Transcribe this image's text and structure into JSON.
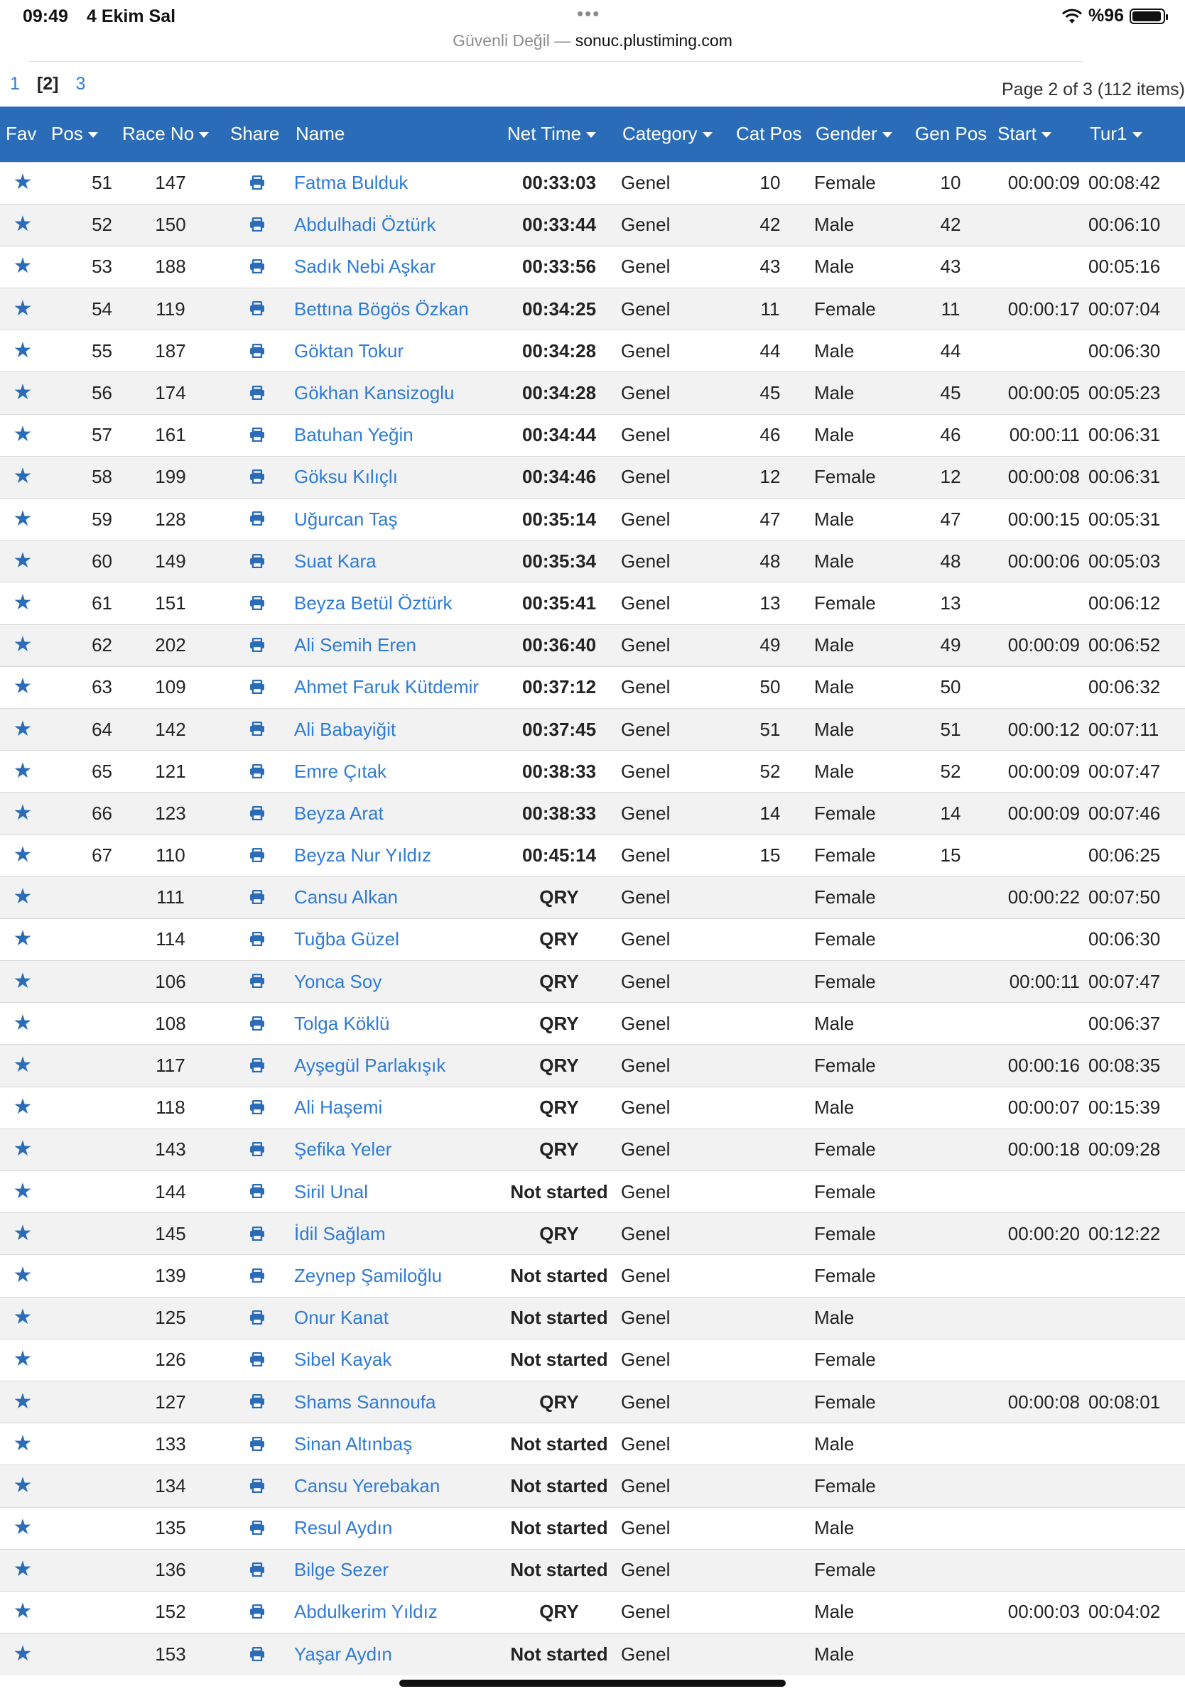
{
  "status_bar": {
    "time": "09:49",
    "date": "4 Ekim Sal",
    "dots": "•••",
    "battery": "%96"
  },
  "url_bar": {
    "security": "Güvenli Değil —",
    "host": "sonuc.plustiming.com"
  },
  "pager": {
    "pages": [
      "1",
      "[2]",
      "3"
    ],
    "info": "Page 2 of 3 (112 items)"
  },
  "columns": [
    {
      "label": "Fav",
      "sort": false
    },
    {
      "label": "Pos",
      "sort": true
    },
    {
      "label": "Race No",
      "sort": true
    },
    {
      "label": "Share",
      "sort": false
    },
    {
      "label": "Name",
      "sort": false
    },
    {
      "label": "Net Time",
      "sort": true
    },
    {
      "label": "Category",
      "sort": true
    },
    {
      "label": "Cat Pos",
      "sort": false
    },
    {
      "label": "Gender",
      "sort": true
    },
    {
      "label": "Gen Pos",
      "sort": false
    },
    {
      "label": "Start",
      "sort": true
    },
    {
      "label": "Tur1",
      "sort": true
    }
  ],
  "rows": [
    {
      "pos": "51",
      "race_no": "147",
      "name": "Fatma Bulduk",
      "net": "00:33:03",
      "category": "Genel",
      "cat_pos": "10",
      "gender": "Female",
      "gen_pos": "10",
      "start": "00:00:09",
      "tur1": "00:08:42"
    },
    {
      "pos": "52",
      "race_no": "150",
      "name": "Abdulhadi Öztürk",
      "net": "00:33:44",
      "category": "Genel",
      "cat_pos": "42",
      "gender": "Male",
      "gen_pos": "42",
      "start": "",
      "tur1": "00:06:10"
    },
    {
      "pos": "53",
      "race_no": "188",
      "name": "Sadık Nebi Aşkar",
      "net": "00:33:56",
      "category": "Genel",
      "cat_pos": "43",
      "gender": "Male",
      "gen_pos": "43",
      "start": "",
      "tur1": "00:05:16"
    },
    {
      "pos": "54",
      "race_no": "119",
      "name": "Bettına Bögös Özkan",
      "net": "00:34:25",
      "category": "Genel",
      "cat_pos": "11",
      "gender": "Female",
      "gen_pos": "11",
      "start": "00:00:17",
      "tur1": "00:07:04"
    },
    {
      "pos": "55",
      "race_no": "187",
      "name": "Göktan Tokur",
      "net": "00:34:28",
      "category": "Genel",
      "cat_pos": "44",
      "gender": "Male",
      "gen_pos": "44",
      "start": "",
      "tur1": "00:06:30"
    },
    {
      "pos": "56",
      "race_no": "174",
      "name": "Gökhan Kansizoglu",
      "net": "00:34:28",
      "category": "Genel",
      "cat_pos": "45",
      "gender": "Male",
      "gen_pos": "45",
      "start": "00:00:05",
      "tur1": "00:05:23"
    },
    {
      "pos": "57",
      "race_no": "161",
      "name": "Batuhan Yeğin",
      "net": "00:34:44",
      "category": "Genel",
      "cat_pos": "46",
      "gender": "Male",
      "gen_pos": "46",
      "start": "00:00:11",
      "tur1": "00:06:31"
    },
    {
      "pos": "58",
      "race_no": "199",
      "name": "Göksu Kılıçlı",
      "net": "00:34:46",
      "category": "Genel",
      "cat_pos": "12",
      "gender": "Female",
      "gen_pos": "12",
      "start": "00:00:08",
      "tur1": "00:06:31"
    },
    {
      "pos": "59",
      "race_no": "128",
      "name": "Uğurcan Taş",
      "net": "00:35:14",
      "category": "Genel",
      "cat_pos": "47",
      "gender": "Male",
      "gen_pos": "47",
      "start": "00:00:15",
      "tur1": "00:05:31"
    },
    {
      "pos": "60",
      "race_no": "149",
      "name": "Suat Kara",
      "net": "00:35:34",
      "category": "Genel",
      "cat_pos": "48",
      "gender": "Male",
      "gen_pos": "48",
      "start": "00:00:06",
      "tur1": "00:05:03"
    },
    {
      "pos": "61",
      "race_no": "151",
      "name": "Beyza Betül Öztürk",
      "net": "00:35:41",
      "category": "Genel",
      "cat_pos": "13",
      "gender": "Female",
      "gen_pos": "13",
      "start": "",
      "tur1": "00:06:12"
    },
    {
      "pos": "62",
      "race_no": "202",
      "name": "Ali Semih Eren",
      "net": "00:36:40",
      "category": "Genel",
      "cat_pos": "49",
      "gender": "Male",
      "gen_pos": "49",
      "start": "00:00:09",
      "tur1": "00:06:52"
    },
    {
      "pos": "63",
      "race_no": "109",
      "name": "Ahmet Faruk Kütdemir",
      "net": "00:37:12",
      "category": "Genel",
      "cat_pos": "50",
      "gender": "Male",
      "gen_pos": "50",
      "start": "",
      "tur1": "00:06:32"
    },
    {
      "pos": "64",
      "race_no": "142",
      "name": "Ali Babayiğit",
      "net": "00:37:45",
      "category": "Genel",
      "cat_pos": "51",
      "gender": "Male",
      "gen_pos": "51",
      "start": "00:00:12",
      "tur1": "00:07:11"
    },
    {
      "pos": "65",
      "race_no": "121",
      "name": "Emre Çıtak",
      "net": "00:38:33",
      "category": "Genel",
      "cat_pos": "52",
      "gender": "Male",
      "gen_pos": "52",
      "start": "00:00:09",
      "tur1": "00:07:47"
    },
    {
      "pos": "66",
      "race_no": "123",
      "name": "Beyza Arat",
      "net": "00:38:33",
      "category": "Genel",
      "cat_pos": "14",
      "gender": "Female",
      "gen_pos": "14",
      "start": "00:00:09",
      "tur1": "00:07:46"
    },
    {
      "pos": "67",
      "race_no": "110",
      "name": "Beyza Nur Yıldız",
      "net": "00:45:14",
      "category": "Genel",
      "cat_pos": "15",
      "gender": "Female",
      "gen_pos": "15",
      "start": "",
      "tur1": "00:06:25"
    },
    {
      "pos": "",
      "race_no": "111",
      "name": "Cansu Alkan",
      "net": "QRY",
      "category": "Genel",
      "cat_pos": "",
      "gender": "Female",
      "gen_pos": "",
      "start": "00:00:22",
      "tur1": "00:07:50"
    },
    {
      "pos": "",
      "race_no": "114",
      "name": "Tuğba Güzel",
      "net": "QRY",
      "category": "Genel",
      "cat_pos": "",
      "gender": "Female",
      "gen_pos": "",
      "start": "",
      "tur1": "00:06:30"
    },
    {
      "pos": "",
      "race_no": "106",
      "name": "Yonca Soy",
      "net": "QRY",
      "category": "Genel",
      "cat_pos": "",
      "gender": "Female",
      "gen_pos": "",
      "start": "00:00:11",
      "tur1": "00:07:47"
    },
    {
      "pos": "",
      "race_no": "108",
      "name": "Tolga Köklü",
      "net": "QRY",
      "category": "Genel",
      "cat_pos": "",
      "gender": "Male",
      "gen_pos": "",
      "start": "",
      "tur1": "00:06:37"
    },
    {
      "pos": "",
      "race_no": "117",
      "name": "Ayşegül Parlakışık",
      "net": "QRY",
      "category": "Genel",
      "cat_pos": "",
      "gender": "Female",
      "gen_pos": "",
      "start": "00:00:16",
      "tur1": "00:08:35"
    },
    {
      "pos": "",
      "race_no": "118",
      "name": "Ali Haşemi",
      "net": "QRY",
      "category": "Genel",
      "cat_pos": "",
      "gender": "Male",
      "gen_pos": "",
      "start": "00:00:07",
      "tur1": "00:15:39"
    },
    {
      "pos": "",
      "race_no": "143",
      "name": "Şefika Yeler",
      "net": "QRY",
      "category": "Genel",
      "cat_pos": "",
      "gender": "Female",
      "gen_pos": "",
      "start": "00:00:18",
      "tur1": "00:09:28"
    },
    {
      "pos": "",
      "race_no": "144",
      "name": "Siril Unal",
      "net": "Not started",
      "category": "Genel",
      "cat_pos": "",
      "gender": "Female",
      "gen_pos": "",
      "start": "",
      "tur1": ""
    },
    {
      "pos": "",
      "race_no": "145",
      "name": "İdil Sağlam",
      "net": "QRY",
      "category": "Genel",
      "cat_pos": "",
      "gender": "Female",
      "gen_pos": "",
      "start": "00:00:20",
      "tur1": "00:12:22"
    },
    {
      "pos": "",
      "race_no": "139",
      "name": "Zeynep Şamiloğlu",
      "net": "Not started",
      "category": "Genel",
      "cat_pos": "",
      "gender": "Female",
      "gen_pos": "",
      "start": "",
      "tur1": ""
    },
    {
      "pos": "",
      "race_no": "125",
      "name": "Onur Kanat",
      "net": "Not started",
      "category": "Genel",
      "cat_pos": "",
      "gender": "Male",
      "gen_pos": "",
      "start": "",
      "tur1": ""
    },
    {
      "pos": "",
      "race_no": "126",
      "name": "Sibel Kayak",
      "net": "Not started",
      "category": "Genel",
      "cat_pos": "",
      "gender": "Female",
      "gen_pos": "",
      "start": "",
      "tur1": ""
    },
    {
      "pos": "",
      "race_no": "127",
      "name": "Shams Sannoufa",
      "net": "QRY",
      "category": "Genel",
      "cat_pos": "",
      "gender": "Female",
      "gen_pos": "",
      "start": "00:00:08",
      "tur1": "00:08:01"
    },
    {
      "pos": "",
      "race_no": "133",
      "name": "Sinan Altınbaş",
      "net": "Not started",
      "category": "Genel",
      "cat_pos": "",
      "gender": "Male",
      "gen_pos": "",
      "start": "",
      "tur1": ""
    },
    {
      "pos": "",
      "race_no": "134",
      "name": "Cansu Yerebakan",
      "net": "Not started",
      "category": "Genel",
      "cat_pos": "",
      "gender": "Female",
      "gen_pos": "",
      "start": "",
      "tur1": ""
    },
    {
      "pos": "",
      "race_no": "135",
      "name": "Resul Aydın",
      "net": "Not started",
      "category": "Genel",
      "cat_pos": "",
      "gender": "Male",
      "gen_pos": "",
      "start": "",
      "tur1": ""
    },
    {
      "pos": "",
      "race_no": "136",
      "name": "Bilge Sezer",
      "net": "Not started",
      "category": "Genel",
      "cat_pos": "",
      "gender": "Female",
      "gen_pos": "",
      "start": "",
      "tur1": ""
    },
    {
      "pos": "",
      "race_no": "152",
      "name": "Abdulkerim Yıldız",
      "net": "QRY",
      "category": "Genel",
      "cat_pos": "",
      "gender": "Male",
      "gen_pos": "",
      "start": "00:00:03",
      "tur1": "00:04:02"
    },
    {
      "pos": "",
      "race_no": "153",
      "name": "Yaşar Aydın",
      "net": "Not started",
      "category": "Genel",
      "cat_pos": "",
      "gender": "Male",
      "gen_pos": "",
      "start": "",
      "tur1": ""
    }
  ],
  "colors": {
    "header_bg": "#2a6cb7",
    "link": "#2f7bd6",
    "icon": "#2a6cb7",
    "row_alt": "#f2f2f2"
  },
  "icons": {
    "fav": "star-icon",
    "share": "printer-icon"
  }
}
